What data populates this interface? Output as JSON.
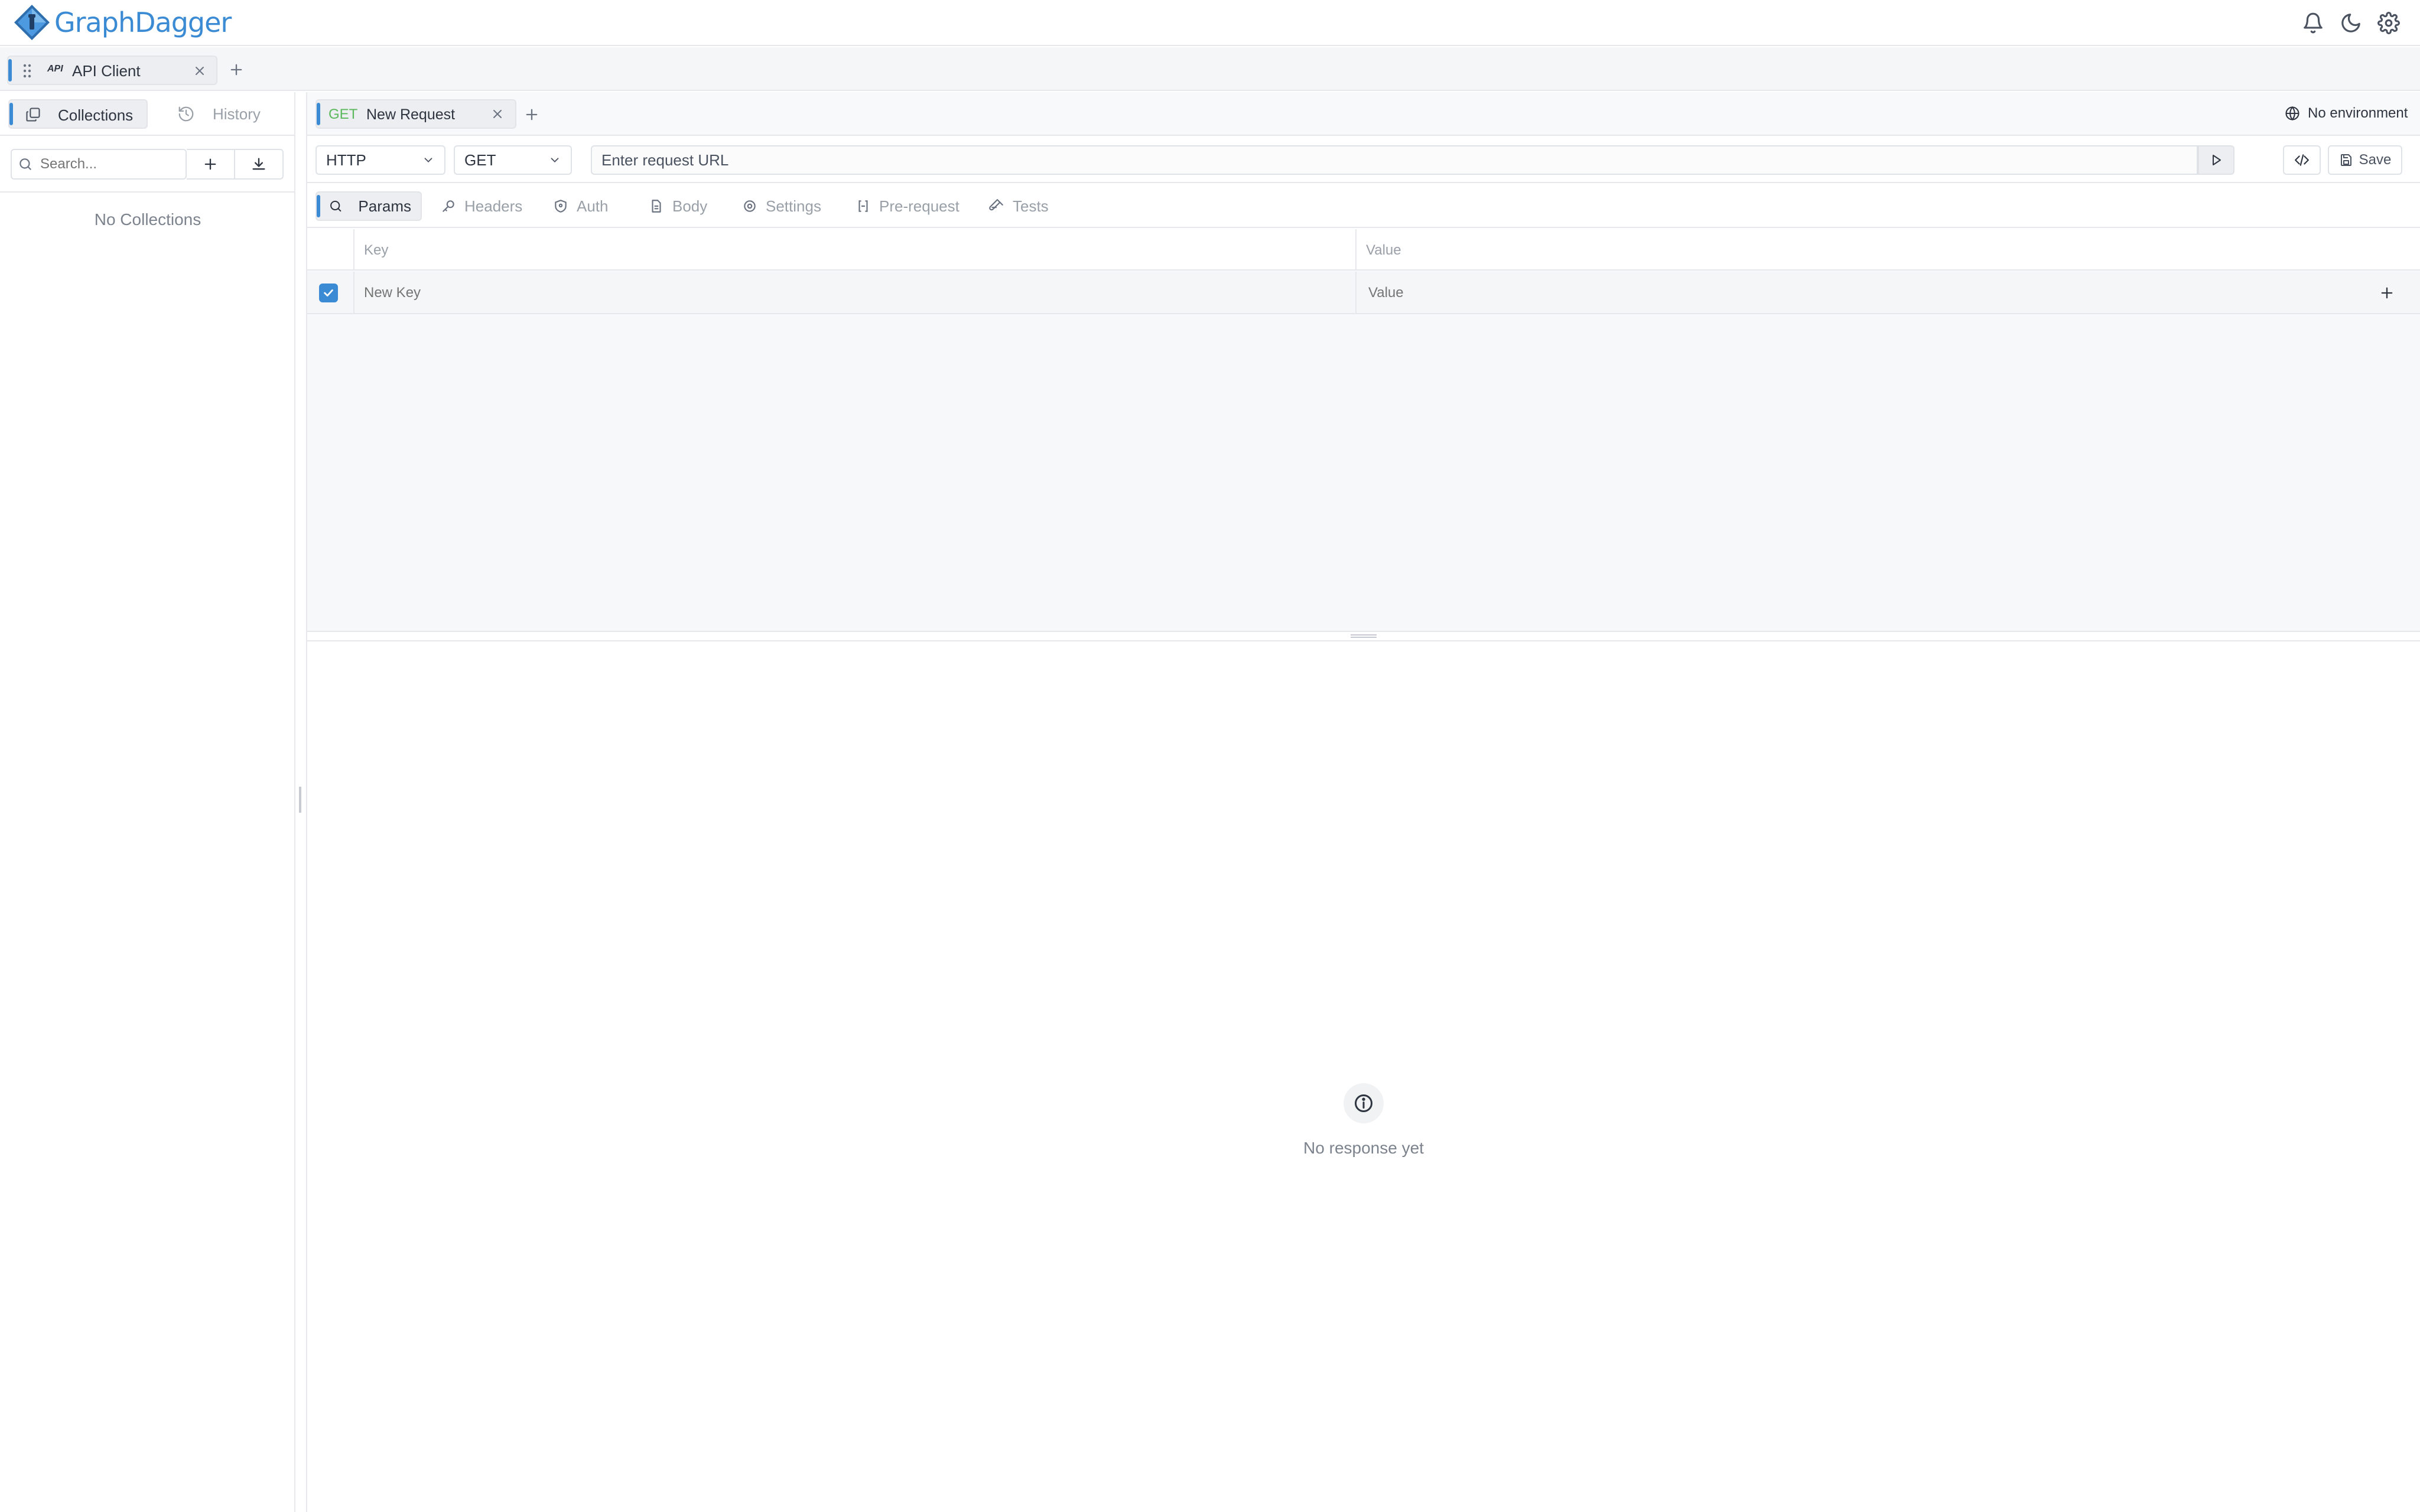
{
  "app": {
    "name": "GraphDagger"
  },
  "workspace_tabs": [
    {
      "badge": "API",
      "label": "API Client"
    }
  ],
  "sidebar": {
    "tabs": [
      {
        "label": "Collections",
        "active": true
      },
      {
        "label": "History",
        "active": false
      }
    ],
    "search_placeholder": "Search...",
    "empty_text": "No Collections"
  },
  "request_tabs": [
    {
      "method": "GET",
      "label": "New Request"
    }
  ],
  "environment": {
    "label": "No environment"
  },
  "request": {
    "protocol": "HTTP",
    "method": "GET",
    "url_placeholder": "Enter request URL",
    "save_label": "Save"
  },
  "sub_tabs": [
    {
      "label": "Params",
      "icon": "search-icon",
      "active": true
    },
    {
      "label": "Headers",
      "icon": "key-icon"
    },
    {
      "label": "Auth",
      "icon": "shield-icon"
    },
    {
      "label": "Body",
      "icon": "document-icon"
    },
    {
      "label": "Settings",
      "icon": "gear-icon"
    },
    {
      "label": "Pre-request",
      "icon": "braces-icon"
    },
    {
      "label": "Tests",
      "icon": "flask-icon"
    }
  ],
  "params": {
    "headers": {
      "key": "Key",
      "value": "Value"
    },
    "rows": [
      {
        "checked": true,
        "key": "New Key",
        "value": "Value"
      }
    ]
  },
  "response": {
    "empty_text": "No response yet"
  },
  "colors": {
    "accent": "#3b8bd4",
    "method_get": "#5cb85c"
  }
}
